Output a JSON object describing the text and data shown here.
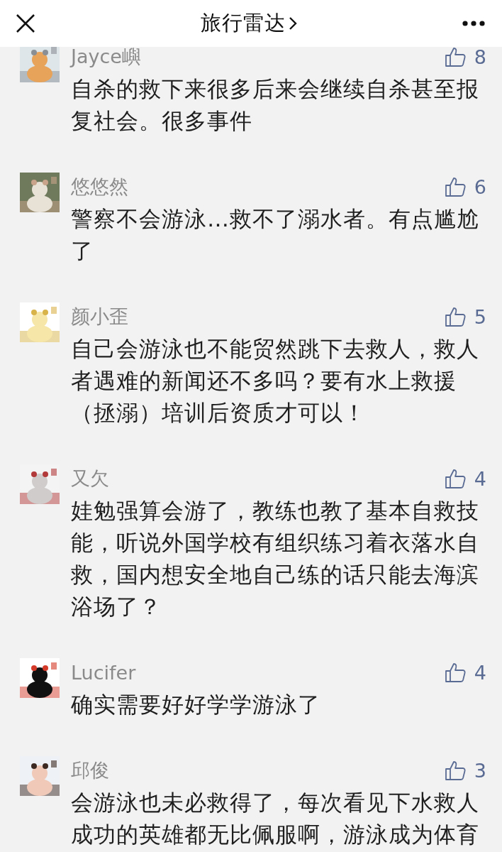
{
  "header": {
    "title": "旅行雷达"
  },
  "comments": [
    {
      "author": "Jayce嶼",
      "likes": "8",
      "text": "自杀的救下来很多后来会继续自杀甚至报复社会。很多事件"
    },
    {
      "author": "悠悠然",
      "likes": "6",
      "text": "警察不会游泳…救不了溺水者。有点尴尬了"
    },
    {
      "author": "颜小歪",
      "likes": "5",
      "text": "自己会游泳也不能贸然跳下去救人，救人者遇难的新闻还不多吗？要有水上救援（拯溺）培训后资质才可以！"
    },
    {
      "author": "又欠",
      "likes": "4",
      "text": "娃勉强算会游了，教练也教了基本自救技能，听说外国学校有组织练习着衣落水自救，国内想安全地自己练的话只能去海滨浴场了？"
    },
    {
      "author": "Lucifer",
      "likes": "4",
      "text": "确实需要好好学学游泳了"
    },
    {
      "author": "邱俊",
      "likes": "3",
      "text": "会游泳也未必救得了，每次看见下水救人成功的英雄都无比佩服啊，游泳成为体育"
    }
  ]
}
